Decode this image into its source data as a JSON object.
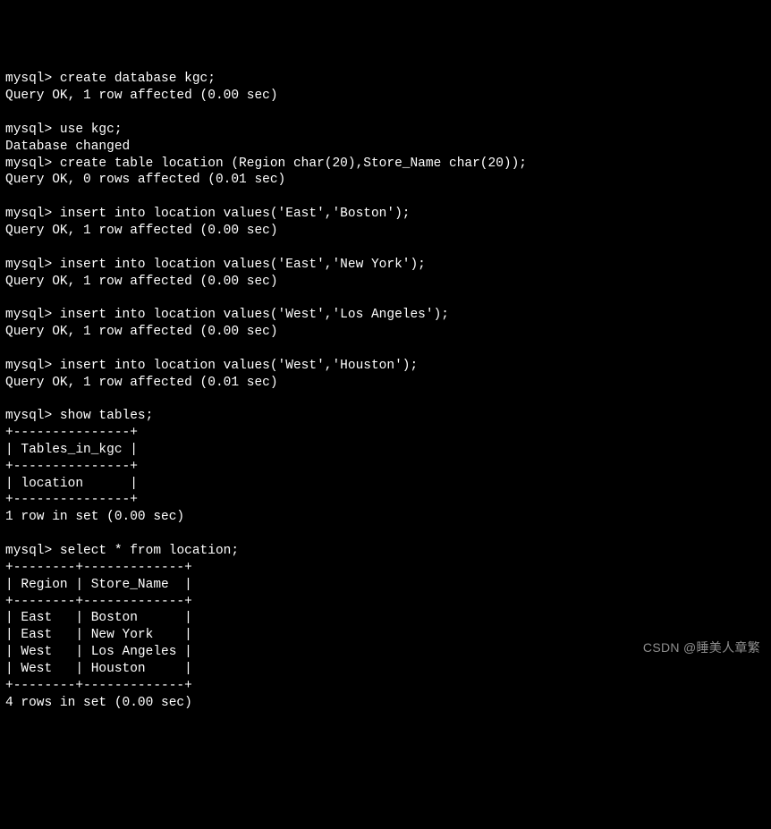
{
  "prompt": "mysql> ",
  "commands": {
    "create_db": "create database kgc;",
    "use_db": "use kgc;",
    "create_table": "create table location (Region char(20),Store_Name char(20));",
    "insert1": "insert into location values('East','Boston');",
    "insert2": "insert into location values('East','New York');",
    "insert3": "insert into location values('West','Los Angeles');",
    "insert4": "insert into location values('West','Houston');",
    "show_tables": "show tables;",
    "select_all": "select * from location;"
  },
  "responses": {
    "ok_1row_000": "Query OK, 1 row affected (0.00 sec)",
    "ok_0rows_001": "Query OK, 0 rows affected (0.01 sec)",
    "ok_1row_001": "Query OK, 1 row affected (0.01 sec)",
    "db_changed": "Database changed",
    "one_row_set": "1 row in set (0.00 sec)",
    "four_rows_set": "4 rows in set (0.00 sec)"
  },
  "tables_result": {
    "border": "+---------------+",
    "header": "| Tables_in_kgc |",
    "row1": "| location      |"
  },
  "select_result": {
    "border": "+--------+-------------+",
    "header": "| Region | Store_Name  |",
    "rows": [
      "| East   | Boston      |",
      "| East   | New York    |",
      "| West   | Los Angeles |",
      "| West   | Houston     |"
    ]
  },
  "watermark": "CSDN @睡美人章繁"
}
